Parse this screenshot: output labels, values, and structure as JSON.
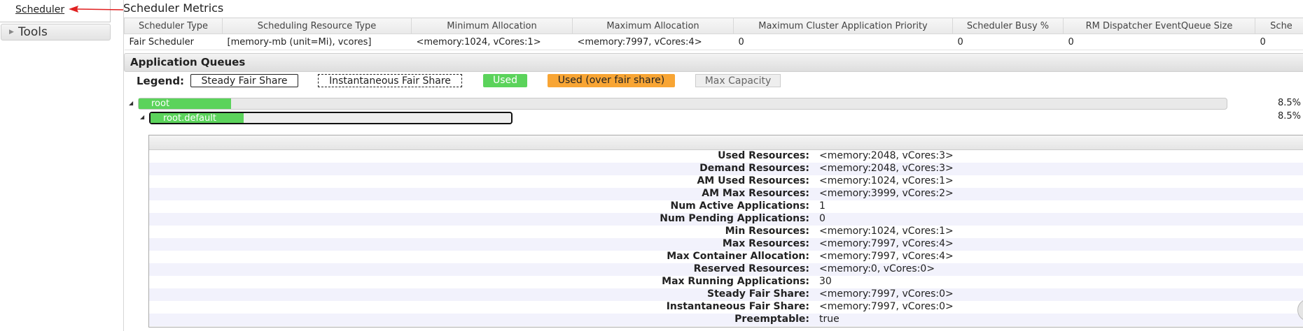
{
  "nav": {
    "scheduler_label": "Scheduler",
    "tools_label": "Tools"
  },
  "metrics": {
    "title": "Scheduler Metrics",
    "columns": [
      "Scheduler Type",
      "Scheduling Resource Type",
      "Minimum Allocation",
      "Maximum Allocation",
      "Maximum Cluster Application Priority",
      "Scheduler Busy %",
      "RM Dispatcher EventQueue Size",
      "Sche"
    ],
    "row": [
      "Fair Scheduler",
      "[memory-mb (unit=Mi), vcores]",
      "<memory:1024, vCores:1>",
      "<memory:7997, vCores:4>",
      "0",
      "0",
      "0",
      "0"
    ]
  },
  "queues": {
    "header": "Application Queues",
    "legend": {
      "label": "Legend:",
      "steady": "Steady Fair Share",
      "instantaneous": "Instantaneous Fair Share",
      "used": "Used",
      "used_over": "Used (over fair share)",
      "max": "Max Capacity"
    },
    "items": [
      {
        "name": "root",
        "percent": "8.5%",
        "used_fraction": 0.085
      },
      {
        "name": "root.default",
        "percent": "8.5%",
        "used_fraction": 0.085
      }
    ]
  },
  "details": [
    {
      "k": "Used Resources:",
      "v": "<memory:2048, vCores:3>"
    },
    {
      "k": "Demand Resources:",
      "v": "<memory:2048, vCores:3>"
    },
    {
      "k": "AM Used Resources:",
      "v": "<memory:1024, vCores:1>"
    },
    {
      "k": "AM Max Resources:",
      "v": "<memory:3999, vCores:2>"
    },
    {
      "k": "Num Active Applications:",
      "v": "1"
    },
    {
      "k": "Num Pending Applications:",
      "v": "0"
    },
    {
      "k": "Min Resources:",
      "v": "<memory:1024, vCores:1>"
    },
    {
      "k": "Max Resources:",
      "v": "<memory:7997, vCores:4>"
    },
    {
      "k": "Max Container Allocation:",
      "v": "<memory:7997, vCores:4>"
    },
    {
      "k": "Reserved Resources:",
      "v": "<memory:0, vCores:0>"
    },
    {
      "k": "Max Running Applications:",
      "v": "30"
    },
    {
      "k": "Steady Fair Share:",
      "v": "<memory:7997, vCores:0>"
    },
    {
      "k": "Instantaneous Fair Share:",
      "v": "<memory:7997, vCores:0>"
    },
    {
      "k": "Preemptable:",
      "v": "true"
    }
  ],
  "colors": {
    "used": "#5bd35b",
    "over": "#f8a534",
    "arrow": "#e02020"
  }
}
